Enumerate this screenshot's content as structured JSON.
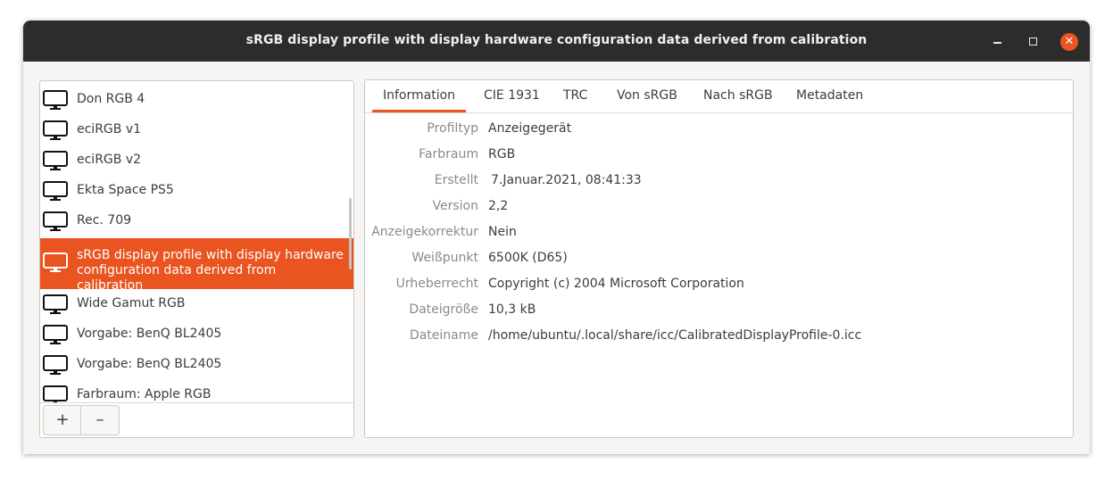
{
  "window": {
    "title": "sRGB display profile with display hardware configuration data derived from calibration",
    "accent_color": "#e95420"
  },
  "profile_list": {
    "items": [
      {
        "label": "Don RGB 4",
        "selected": false
      },
      {
        "label": "eciRGB v1",
        "selected": false
      },
      {
        "label": "eciRGB v2",
        "selected": false
      },
      {
        "label": "Ekta Space PS5",
        "selected": false
      },
      {
        "label": "Rec. 709",
        "selected": false
      },
      {
        "label": "sRGB display profile with display hardware configuration data derived from calibration",
        "selected": true
      },
      {
        "label": "Wide Gamut RGB",
        "selected": false
      },
      {
        "label": "Vorgabe: BenQ BL2405",
        "selected": false
      },
      {
        "label": "Vorgabe: BenQ BL2405",
        "selected": false
      },
      {
        "label": "Farbraum: Apple RGB",
        "selected": false
      }
    ],
    "add_label": "+",
    "remove_label": "–"
  },
  "tabs": [
    {
      "label": "Information",
      "active": true
    },
    {
      "label": "CIE 1931",
      "active": false
    },
    {
      "label": "TRC",
      "active": false
    },
    {
      "label": "Von sRGB",
      "active": false
    },
    {
      "label": "Nach sRGB",
      "active": false
    },
    {
      "label": "Metadaten",
      "active": false
    }
  ],
  "info": [
    {
      "key": "Profiltyp",
      "value": "Anzeigegerät"
    },
    {
      "key": "Farbraum",
      "value": "RGB"
    },
    {
      "key": "Erstellt",
      "value": "7.Januar.2021, 08:41:33"
    },
    {
      "key": "Version",
      "value": "2,2"
    },
    {
      "key": "Anzeigekorrektur",
      "value": "Nein"
    },
    {
      "key": "Weißpunkt",
      "value": "6500K (D65)"
    },
    {
      "key": "Urheberrecht",
      "value": "Copyright (c) 2004 Microsoft Corporation"
    },
    {
      "key": "Dateigröße",
      "value": "10,3 kB"
    },
    {
      "key": "Dateiname",
      "value": "/home/ubuntu/.local/share/icc/CalibratedDisplayProfile-0.icc"
    }
  ]
}
